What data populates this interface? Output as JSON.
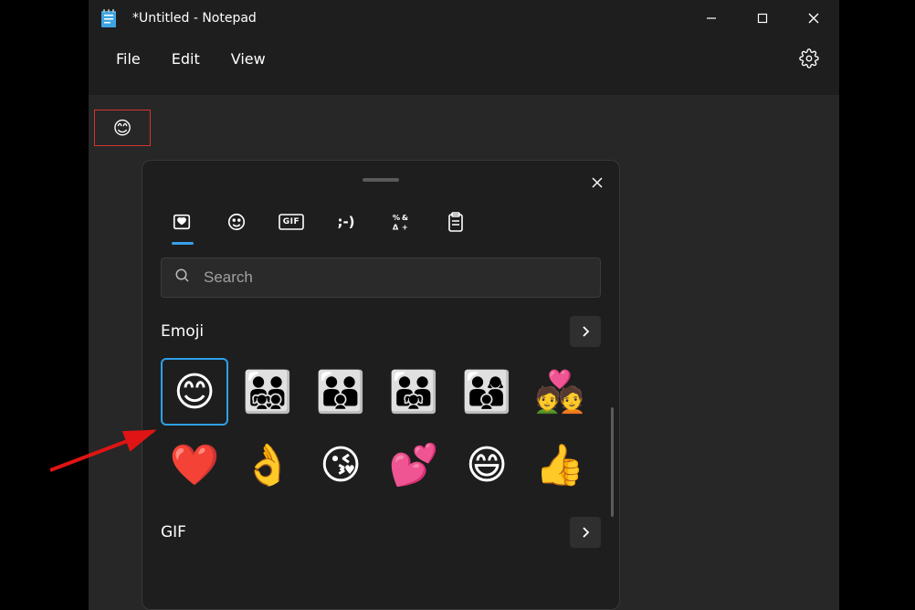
{
  "window": {
    "title": "*Untitled - Notepad"
  },
  "menu": {
    "file": "File",
    "edit": "Edit",
    "view": "View"
  },
  "editor": {
    "inserted_emoji": "😊"
  },
  "emoji_panel": {
    "search_placeholder": "Search",
    "tabs": {
      "recent": "recent-tab",
      "emoji": "emoji-tab",
      "gif": "GIF",
      "kaomoji": ";-)",
      "symbols": "symbols-tab",
      "clipboard": "clipboard-tab"
    },
    "sections": {
      "emoji_title": "Emoji",
      "gif_title": "GIF"
    },
    "grid": [
      "😊",
      "👨‍👨‍👧‍👦",
      "👨‍👨‍👦",
      "👨‍👨‍👧",
      "👨‍👩‍👦",
      "💑",
      "❤️",
      "👌",
      "😘",
      "💕",
      "😄",
      "👍"
    ],
    "selected_index": 0
  }
}
